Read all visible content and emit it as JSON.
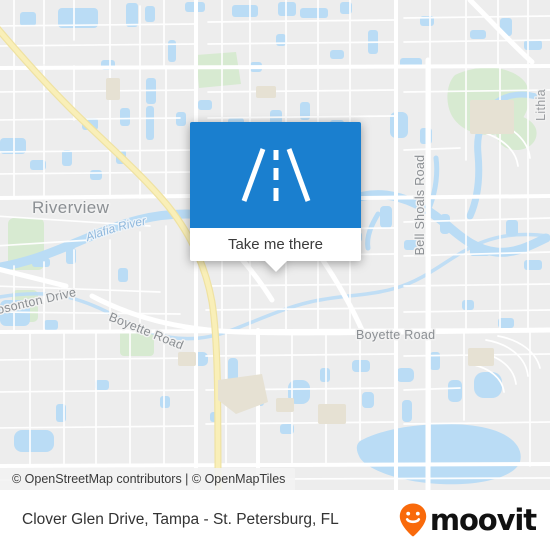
{
  "map": {
    "colors": {
      "land": "#ededed",
      "water": "#b9dcf5",
      "park": "#d6ead0",
      "building": "#e4e0d4",
      "road_white": "#ffffff",
      "highway_yellow": "#f7e9a0",
      "label_gray": "#8b8f93",
      "label_water": "#8fb8dd"
    },
    "labels": [
      {
        "name": "place-riverview",
        "text": "Riverview",
        "kind": "place"
      },
      {
        "name": "water-alafia-river",
        "text": "Alafia River",
        "kind": "water"
      },
      {
        "name": "road-bosonton-drive",
        "text": "osonton Drive",
        "kind": "road"
      },
      {
        "name": "road-boyette-road-west",
        "text": "Boyette Road",
        "kind": "road"
      },
      {
        "name": "road-boyette-road-east",
        "text": "Boyette Road",
        "kind": "road"
      },
      {
        "name": "road-bell-shoals-road",
        "text": "Bell Shoals Road",
        "kind": "road"
      },
      {
        "name": "road-edge-clipped",
        "text": "Lithia",
        "kind": "road"
      }
    ]
  },
  "popup": {
    "icon": "road-icon",
    "header_color": "#1a7fcf",
    "label": "Take me there"
  },
  "attribution": {
    "text": "© OpenStreetMap contributors | © OpenMapTiles"
  },
  "footer": {
    "title": "Clover Glen Drive, Tampa - St. Petersburg, FL",
    "brand_word": "moovit",
    "brand_pin_color": "#f96a0b",
    "brand_pin_icon": "smiley-map-pin-icon"
  }
}
